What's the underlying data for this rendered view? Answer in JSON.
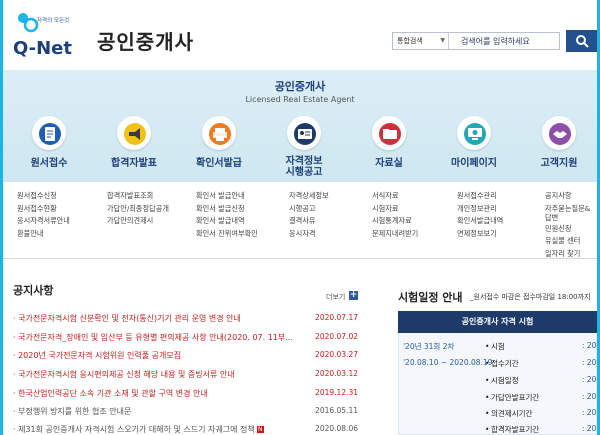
{
  "header": {
    "logo_text": "Q-Net",
    "logo_tagline": "자격의 모든것",
    "brand": "공인중개사",
    "search_select": "통합검색",
    "search_placeholder": "검색어를 입력하세요"
  },
  "banner": {
    "title": "공인중개사",
    "subtitle": "Licensed Real Estate Agent"
  },
  "menu": [
    {
      "label": "원서접수",
      "icon": "document-icon"
    },
    {
      "label": "합격자발표",
      "icon": "megaphone-icon"
    },
    {
      "label": "확인서발급",
      "icon": "printer-icon"
    },
    {
      "label": "자격정보\n시행공고",
      "icon": "id-card-icon"
    },
    {
      "label": "자료실",
      "icon": "folder-icon"
    },
    {
      "label": "마이페이지",
      "icon": "monitor-icon"
    },
    {
      "label": "고객지원",
      "icon": "handshake-icon"
    }
  ],
  "sublists": [
    [
      "원서접수신청",
      "원서접수현황",
      "응시자격서류안내",
      "환불안내"
    ],
    [
      "합격자발표조회",
      "가답안/최종정답공개",
      "가답안의견제시"
    ],
    [
      "확인서 발급안내",
      "확인서 발급신청",
      "확인서 발급내역",
      "확인서 진위여부확인"
    ],
    [
      "자격상세정보",
      "시행공고",
      "결격사유",
      "응시자격"
    ],
    [
      "서식자료",
      "시험자료",
      "시험통계자료",
      "문제지내려받기"
    ],
    [
      "원서접수관리",
      "개인정보관리",
      "확인서발급내역",
      "면제정보보기"
    ],
    [
      "공지사항",
      "자주묻는질문&답변",
      "민원신청",
      "유실물 센터",
      "일자리 찾기"
    ]
  ],
  "notices": {
    "title": "공지사항",
    "more": "더보기",
    "items": [
      {
        "title": "국가전문자격시험 신분확인 및 전자(통신)기기 관리 운영 변경 안내",
        "date": "2020.07.17",
        "style": "red"
      },
      {
        "title": "국가전문자격_장애인 및 임산부 등 유형별 편의제공 사항 안내(2020. 07. 11부...",
        "date": "2020.07.02",
        "style": "red"
      },
      {
        "title": "2020년 국가전문자격 시험위원 인력풀 공개모집",
        "date": "2020.03.27",
        "style": "red"
      },
      {
        "title": "국가전문자격시험 응시편의제공 신청 해당 내용 및 증빙서류 안내",
        "date": "2020.03.12",
        "style": "red"
      },
      {
        "title": "한국산업인력공단 소속 기관 소재 및 관할 구역 변경 안내",
        "date": "2019.12.31",
        "style": "red"
      },
      {
        "title": "부정행위 방지를 위한 협조 안내문",
        "date": "2016.05.11",
        "style": "gray"
      },
      {
        "title": "제31회 공인중개사 자격시험 스오기가 대해하 및 스드기 자궤그에 정책",
        "date": "2020.08.06",
        "style": "gray"
      }
    ]
  },
  "schedule": {
    "title": "시험일정 안내",
    "note": "_원서접수 마감은 접수마감일 18:00까지",
    "head": "공인중개사 자격 시험",
    "round": "'20년 31회 2차",
    "period": "'20.08.10 ~ 2020.08.19",
    "rows": [
      {
        "label": "시험",
        "value": ": 20"
      },
      {
        "label": "접수기간",
        "value": ": 20"
      },
      {
        "label": "시험일정",
        "value": ": 20"
      },
      {
        "label": "가답안발표기간",
        "value": ": 20"
      },
      {
        "label": "의견제시기간",
        "value": ": 20"
      },
      {
        "label": "합격자발표기간",
        "value": ": 20"
      }
    ]
  },
  "colors": {
    "brand_navy": "#1d3f7b",
    "accent_cyan": "#19b5e4",
    "notice_red": "#c21c1c",
    "search_button": "#24508e"
  }
}
